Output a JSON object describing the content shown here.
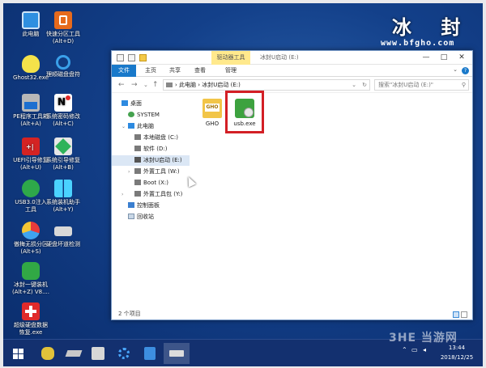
{
  "brand": {
    "title": "冰 封",
    "url": "www.bfgho.com"
  },
  "desktop_icons": [
    {
      "label1": "此电脑",
      "label2": ""
    },
    {
      "label1": "快速分区工具",
      "label2": "(Alt+D)"
    },
    {
      "label1": "Ghost32.exe",
      "label2": ""
    },
    {
      "label1": "理顺磁盘盘符",
      "label2": ""
    },
    {
      "label1": "PE程序工具箱",
      "label2": "(Alt+A)"
    },
    {
      "label1": "系统密码修改",
      "label2": "(Alt+C)"
    },
    {
      "label1": "UEFI引导修复",
      "label2": "(Alt+U)"
    },
    {
      "label1": "系统引导修复",
      "label2": "(Alt+B)"
    },
    {
      "label1": "USB3.0注入",
      "label2": "工具"
    },
    {
      "label1": "系统装机助手",
      "label2": "(Alt+Y)"
    },
    {
      "label1": "傲梅无损分区",
      "label2": "(Alt+S)"
    },
    {
      "label1": "硬盘坏道检测",
      "label2": ""
    },
    {
      "label1": "冰封一键装机",
      "label2": "(Alt+Z) V8...."
    },
    {
      "label1": "超级硬盘数据",
      "label2": "恢复.exe"
    }
  ],
  "window": {
    "context_tab": "驱动器工具",
    "title": "冰封U启动 (E:)",
    "controls": {
      "minimize": "—",
      "maximize": "□",
      "close": "✕"
    },
    "ribbon_tabs": [
      "文件",
      "主页",
      "共享",
      "查看",
      "管理"
    ],
    "address": {
      "back": "←",
      "forward": "→",
      "dropdown": "⌄",
      "up": "↑",
      "path": "›  此电脑  ›  冰封U启动 (E:)",
      "refresh": "↻",
      "expand": "⌄"
    },
    "search_placeholder": "搜索\"冰封U启动 (E:)\"",
    "nav_tree": [
      {
        "label": "桌面"
      },
      {
        "label": "SYSTEM"
      },
      {
        "label": "此电脑"
      },
      {
        "label": "本地磁盘 (C:)"
      },
      {
        "label": "软件 (D:)"
      },
      {
        "label": "冰封U启动 (E:)"
      },
      {
        "label": "外置工具 (W:)"
      },
      {
        "label": "Boot (X:)"
      },
      {
        "label": "外置工具包 (Y:)"
      },
      {
        "label": "控制面板"
      },
      {
        "label": "回收站"
      }
    ],
    "files": [
      {
        "name": "GHO",
        "icon_text": "GHO"
      },
      {
        "name": "usb.exe"
      }
    ],
    "status": "2 个项目"
  },
  "taskbar": {
    "time": "13:44",
    "date": "2018/12/25"
  },
  "watermark": "3HE 当游网",
  "colors": {
    "accent": "#1979ca",
    "highlight": "#d31f25",
    "desktop": "#13408a"
  }
}
